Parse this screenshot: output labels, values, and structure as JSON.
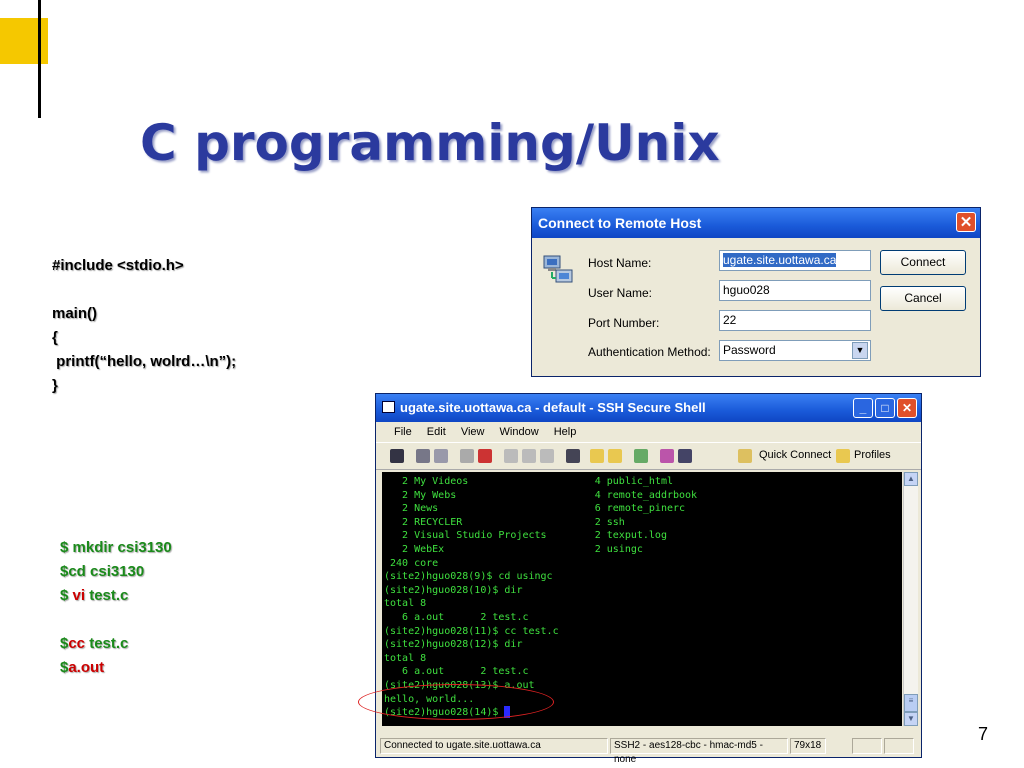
{
  "slide": {
    "title": "C programming/Unix",
    "page_number": "7",
    "code_lines": [
      "#include <stdio.h>",
      "",
      "main()",
      "{",
      " printf(“hello, wolrd…\\n”);",
      "}"
    ],
    "commands": {
      "mkdir": "$ mkdir csi3130",
      "cd": "$cd csi3130",
      "vi_prefix": "$ ",
      "vi_cmd": "vi",
      "vi_arg": " test.c",
      "cc_prefix": "$",
      "cc_cmd": "cc",
      "cc_arg": " test.c",
      "run_prefix": "$",
      "run_cmd": "a.out"
    },
    "colors": {
      "title": "#2b3a9e",
      "accent": "#f5c800",
      "cmd_green": "#1a8a1a",
      "cmd_red": "#cc0000",
      "annotation": "#dd2222"
    }
  },
  "connect_dialog": {
    "title": "Connect to Remote Host",
    "host_label": "Host Name:",
    "host_value": "ugate.site.uottawa.ca",
    "user_label": "User Name:",
    "user_value": "hguo028",
    "port_label": "Port Number:",
    "port_value": "22",
    "auth_label": "Authentication Method:",
    "auth_value": "Password",
    "connect_label": "Connect",
    "cancel_label": "Cancel"
  },
  "ssh_window": {
    "title": "ugate.site.uottawa.ca - default - SSH Secure Shell",
    "menu": [
      "File",
      "Edit",
      "View",
      "Window",
      "Help"
    ],
    "quick_connect_label": "Quick Connect",
    "profiles_label": "Profiles",
    "terminal_lines": [
      "   2 My Videos                     4 public_html",
      "   2 My Webs                       4 remote_addrbook",
      "   2 News                          6 remote_pinerc",
      "   2 RECYCLER                      2 ssh",
      "   2 Visual Studio Projects        2 texput.log",
      "   2 WebEx                         2 usingc",
      " 240 core",
      "(site2)hguo028(9)$ cd usingc",
      "(site2)hguo028(10)$ dir",
      "total 8",
      "   6 a.out      2 test.c",
      "(site2)hguo028(11)$ cc test.c",
      "(site2)hguo028(12)$ dir",
      "total 8",
      "   6 a.out      2 test.c",
      "(site2)hguo028(13)$ a.out",
      "hello, world...",
      "(site2)hguo028(14)$ "
    ],
    "status_connected": "Connected to ugate.site.uottawa.ca",
    "status_cipher": "SSH2 - aes128-cbc - hmac-md5 - none",
    "status_size": "79x18"
  }
}
